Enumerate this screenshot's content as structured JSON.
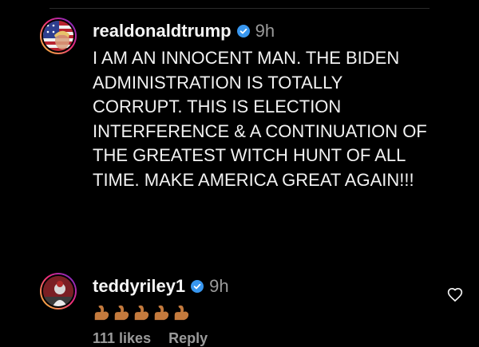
{
  "comments": [
    {
      "username": "realdonaldtrump",
      "time": "9h",
      "text": "I AM AN INNOCENT MAN. THE BIDEN ADMINISTRATION IS TOTALLY CORRUPT. THIS IS ELECTION INTERFERENCE & A CONTINUATION OF THE GREATEST WITCH HUNT OF ALL TIME. MAKE AMERICA GREAT AGAIN!!!"
    },
    {
      "username": "teddyriley1",
      "time": "9h",
      "emoji_count": 5,
      "likes": "111 likes",
      "reply_label": "Reply"
    }
  ],
  "colors": {
    "background": "#000000",
    "verified_badge": "#3897f0",
    "muted_text": "#9a9a9a",
    "emoji": "#c47a3d"
  },
  "icons": {
    "verified": "verified-badge-icon",
    "like": "heart-outline-icon",
    "emoji": "flexed-biceps-emoji"
  }
}
